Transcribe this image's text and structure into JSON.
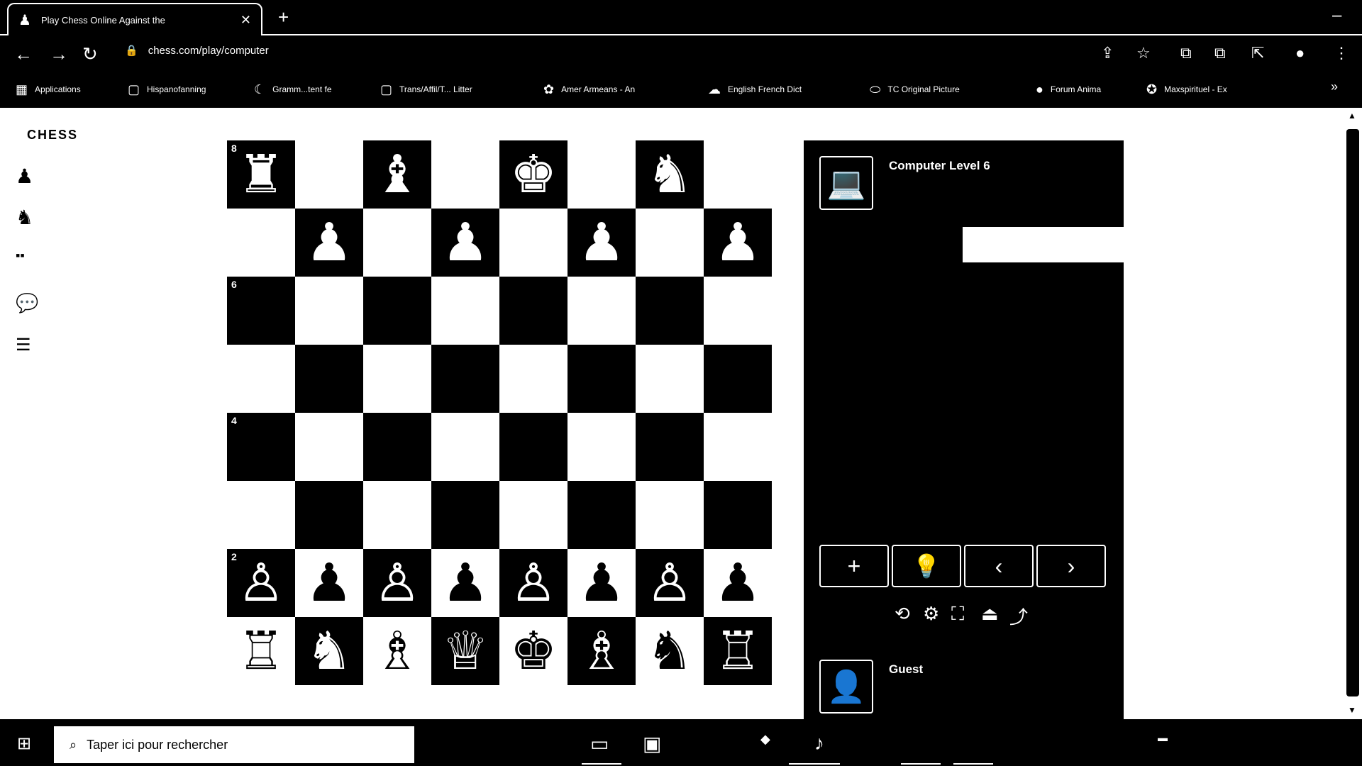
{
  "browser": {
    "tab_title": "Play Chess Online Against the",
    "tab_close": "✕",
    "new_tab": "+",
    "window_min": "–",
    "back": "←",
    "forward": "→",
    "reload": "↻",
    "url": "chess.com/play/computer",
    "lock": "🔒",
    "right_icons": [
      "⇪",
      "☆",
      "⧉",
      "⧉",
      "⇱",
      "●",
      "⋮"
    ]
  },
  "bookmarks": [
    {
      "icon": "▦",
      "label": "Applications"
    },
    {
      "icon": "▢",
      "label": "Hispanofanning"
    },
    {
      "icon": "☾",
      "label": "Gramm...tent fe"
    },
    {
      "icon": "▢",
      "label": "Trans/Affil/T... Litter"
    },
    {
      "icon": "✿",
      "label": "Amer Armeans - An"
    },
    {
      "icon": "☁",
      "label": "English French Dict"
    },
    {
      "icon": "⬭",
      "label": "TC Original Picture"
    },
    {
      "icon": "●",
      "label": "Forum Anima"
    },
    {
      "icon": "✪",
      "label": "Maxspirituel - Ex"
    }
  ],
  "bookmarks_more": "»",
  "site": {
    "logo": "CHESS",
    "left_nav": [
      "♟",
      "♞",
      "▪▪",
      "💬",
      "☰"
    ]
  },
  "board": {
    "rank_labels": {
      "0": "8",
      "2": "6",
      "4": "4",
      "6": "2"
    },
    "rows": [
      [
        "♜",
        "",
        "♝",
        "",
        "♚",
        "",
        "♞",
        ""
      ],
      [
        "",
        "♟",
        "",
        "♟",
        "",
        "♟",
        "",
        "♟"
      ],
      [
        "",
        "",
        "",
        "",
        "",
        "",
        "",
        ""
      ],
      [
        "",
        "",
        "",
        "",
        "",
        "",
        "",
        ""
      ],
      [
        "",
        "",
        "",
        "",
        "",
        "",
        "",
        ""
      ],
      [
        "",
        "",
        "",
        "",
        "",
        "",
        "",
        ""
      ],
      [
        "♙",
        "♟",
        "♙",
        "♟",
        "♙",
        "♟",
        "♙",
        "♟"
      ],
      [
        "♖",
        "♞",
        "♗",
        "♕",
        "♚",
        "♗",
        "♞",
        "♖"
      ]
    ]
  },
  "panel": {
    "opponent": "Computer Level 6",
    "opponent_icon": "💻",
    "clock": "",
    "controls": [
      "+",
      "💡",
      "‹",
      "›"
    ],
    "tools": [
      "⟲",
      "⚙",
      "⛶",
      "⏏",
      "⤴"
    ],
    "player": "Guest",
    "player_icon": "👤"
  },
  "taskbar": {
    "start": "⊞",
    "search_icon": "⌕",
    "search_placeholder": "Taper ici pour rechercher",
    "apps": [
      "▭",
      "▣",
      "◆",
      "♪",
      "▬"
    ]
  }
}
